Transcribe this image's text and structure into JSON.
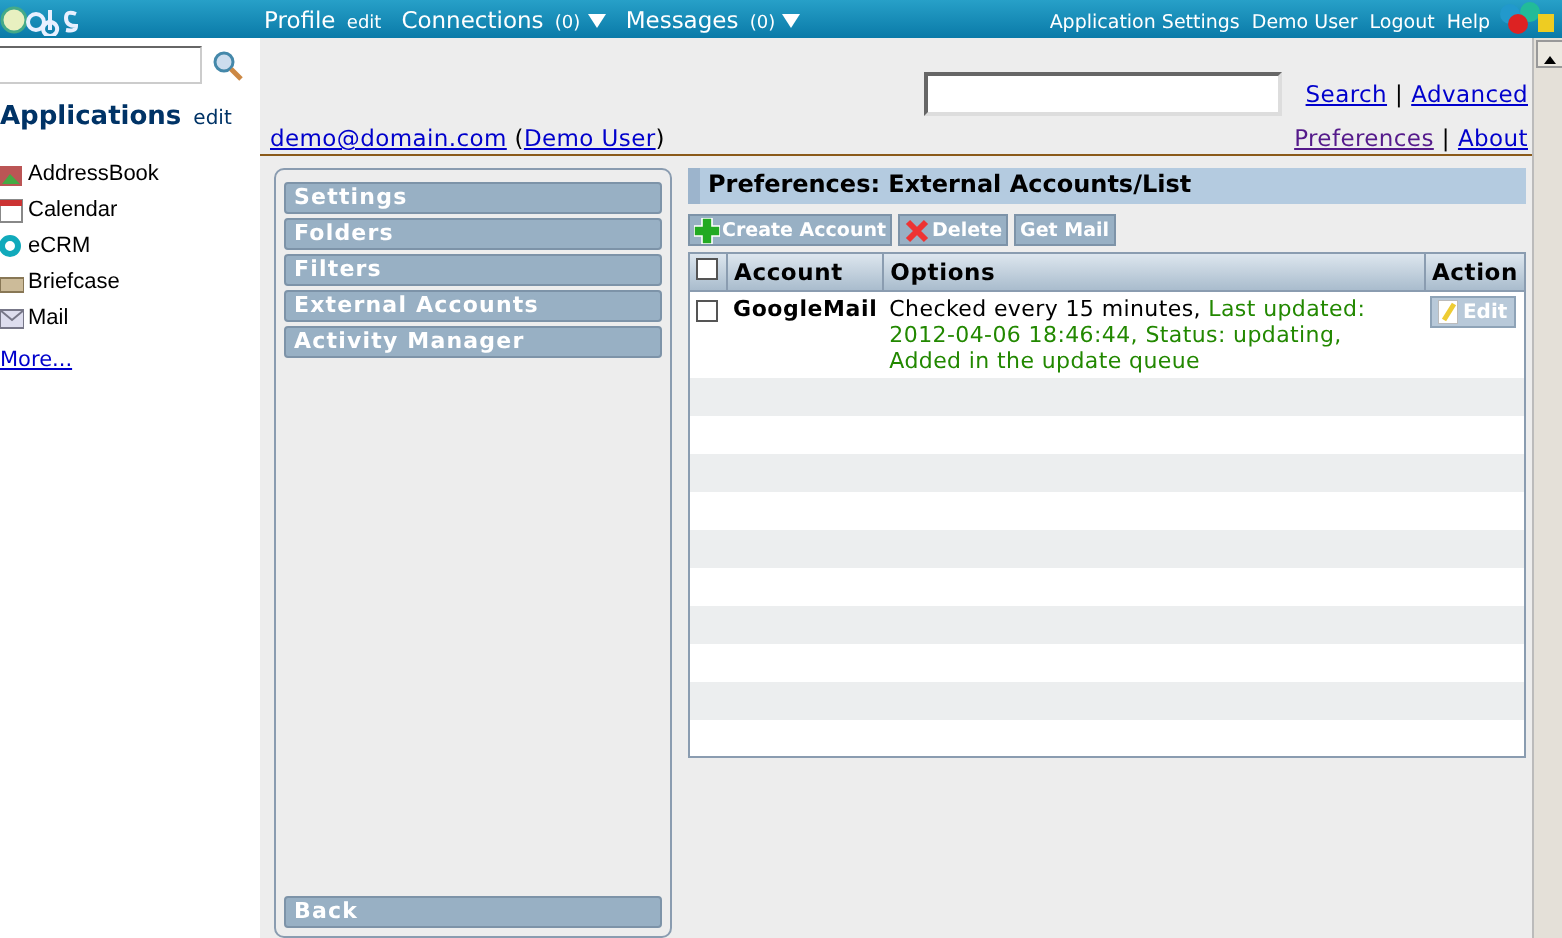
{
  "top_bar": {
    "menus": [
      {
        "label": "Profile",
        "extra": "edit"
      },
      {
        "label": "Connections",
        "extra": "(0)"
      },
      {
        "label": "Messages",
        "extra": "(0)"
      }
    ],
    "links": [
      "Application Settings",
      "Demo User",
      "Logout",
      "Help"
    ]
  },
  "sidebar": {
    "applications_title": "Applications",
    "edit_link": "edit",
    "apps": [
      "AddressBook",
      "Calendar",
      "eCRM",
      "Briefcase",
      "Mail"
    ],
    "more_link": "More..."
  },
  "header": {
    "search_link": "Search",
    "advanced_link": "Advanced",
    "separator_1": "|",
    "user_email": "demo@domain.com",
    "open_paren": "(",
    "user_name": "Demo User",
    "close_paren": ")",
    "preferences_link": "Preferences",
    "about_link": "About",
    "separator_2": "|"
  },
  "nav": {
    "items": [
      "Settings",
      "Folders",
      "Filters",
      "External Accounts",
      "Activity Manager"
    ],
    "back": "Back"
  },
  "content": {
    "title": "Preferences: External Accounts/List",
    "toolbar": [
      {
        "kind": "add",
        "label": "Create Account"
      },
      {
        "kind": "delete",
        "label": "Delete"
      },
      {
        "kind": "plain",
        "label": "Get Mail"
      }
    ],
    "table": {
      "columns": [
        "Account",
        "Options",
        "Action"
      ],
      "select_all_checked": false,
      "rows": [
        {
          "checked": false,
          "account": "GoogleMail",
          "schedule": "Checked every 15 minutes,",
          "status": "Last updated: 2012-04-06 18:46:44, Status: updating, Added in the update queue",
          "action": "Edit"
        }
      ]
    }
  }
}
